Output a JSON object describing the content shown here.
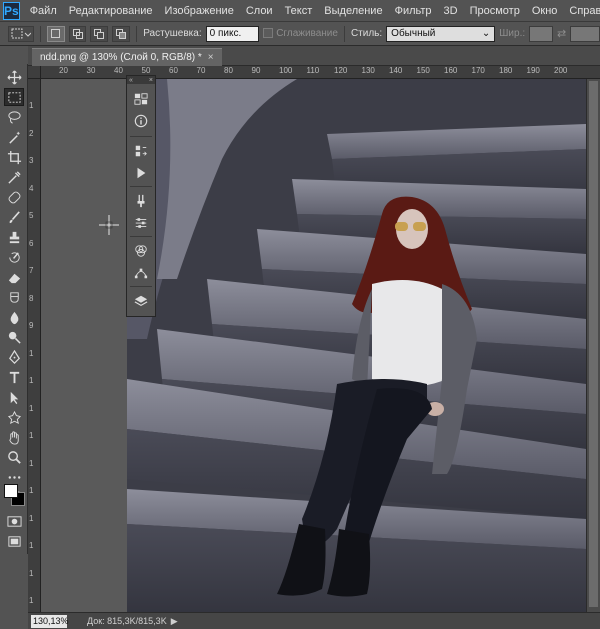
{
  "app": {
    "logo_text": "Ps"
  },
  "menu": [
    "Файл",
    "Редактирование",
    "Изображение",
    "Слои",
    "Текст",
    "Выделение",
    "Фильтр",
    "3D",
    "Просмотр",
    "Окно",
    "Справка"
  ],
  "options": {
    "feather_label": "Растушевка:",
    "feather_value": "0 пикс.",
    "antialias_label": "Сглаживание",
    "style_label": "Стиль:",
    "style_value": "Обычный",
    "width_label": "Шир.:"
  },
  "document": {
    "tab_title": "ndd.png @ 130% (Слой 0, RGB/8) *",
    "close_glyph": "×"
  },
  "rulers": {
    "top": [
      "20",
      "30",
      "40",
      "50",
      "60",
      "70",
      "80",
      "90",
      "100",
      "110",
      "120",
      "130",
      "140",
      "150",
      "160",
      "170",
      "180",
      "190",
      "200"
    ],
    "left": [
      "1",
      "2",
      "3",
      "4",
      "5",
      "6",
      "7",
      "8",
      "9",
      "1",
      "1",
      "1",
      "1",
      "1",
      "1",
      "1",
      "1",
      "1",
      "1"
    ]
  },
  "panel_strip": {
    "collapse_glyph": "«",
    "close_glyph": "×"
  },
  "status": {
    "zoom": "130,13%",
    "doc_info": "Док: 815,3K/815,3K",
    "arrow": "▶"
  },
  "colors": {
    "foreground": "#ffffff",
    "background": "#000000",
    "ui_bg": "#535353",
    "accent": "#31a8ff"
  },
  "icons": {
    "toolbar": [
      "move-icon",
      "marquee-icon",
      "lasso-icon",
      "magic-wand-icon",
      "crop-icon",
      "eyedropper-icon",
      "healing-brush-icon",
      "brush-icon",
      "clone-stamp-icon",
      "history-brush-icon",
      "eraser-icon",
      "gradient-icon",
      "blur-icon",
      "dodge-icon",
      "pen-icon",
      "type-icon",
      "path-selection-icon",
      "shape-icon",
      "hand-icon",
      "zoom-icon",
      "more-tools-icon"
    ],
    "panel": [
      "color-swatches-icon",
      "info-icon",
      "history-icon",
      "actions-icon",
      "brush-settings-icon",
      "properties-icon",
      "channels-icon",
      "paths-icon",
      "layers-icon"
    ]
  }
}
